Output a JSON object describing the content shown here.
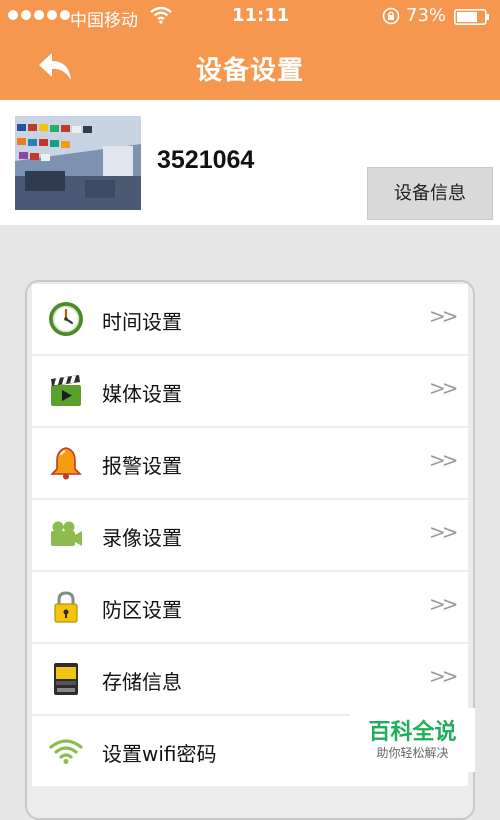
{
  "status_bar": {
    "carrier": "中国移动",
    "time": "11:11",
    "battery_pct": "73%"
  },
  "nav": {
    "title": "设备设置"
  },
  "device": {
    "id": "3521064",
    "info_button": "设备信息"
  },
  "menu": {
    "items": [
      {
        "label": "时间设置",
        "icon": "clock-icon",
        "arrow": ">>"
      },
      {
        "label": "媒体设置",
        "icon": "clapperboard-icon",
        "arrow": ">>"
      },
      {
        "label": "报警设置",
        "icon": "bell-icon",
        "arrow": ">>"
      },
      {
        "label": "录像设置",
        "icon": "video-camera-icon",
        "arrow": ">>"
      },
      {
        "label": "防区设置",
        "icon": "padlock-icon",
        "arrow": ">>"
      },
      {
        "label": "存储信息",
        "icon": "sd-card-icon",
        "arrow": ">>"
      },
      {
        "label": "设置wifi密码",
        "icon": "wifi-icon",
        "arrow": ""
      }
    ]
  },
  "watermark": {
    "main": "百科全说",
    "sub": "助你轻松解决"
  },
  "colors": {
    "header": "#f5974e",
    "background": "#e6e6e6",
    "watermark_green": "#1fae5a"
  }
}
